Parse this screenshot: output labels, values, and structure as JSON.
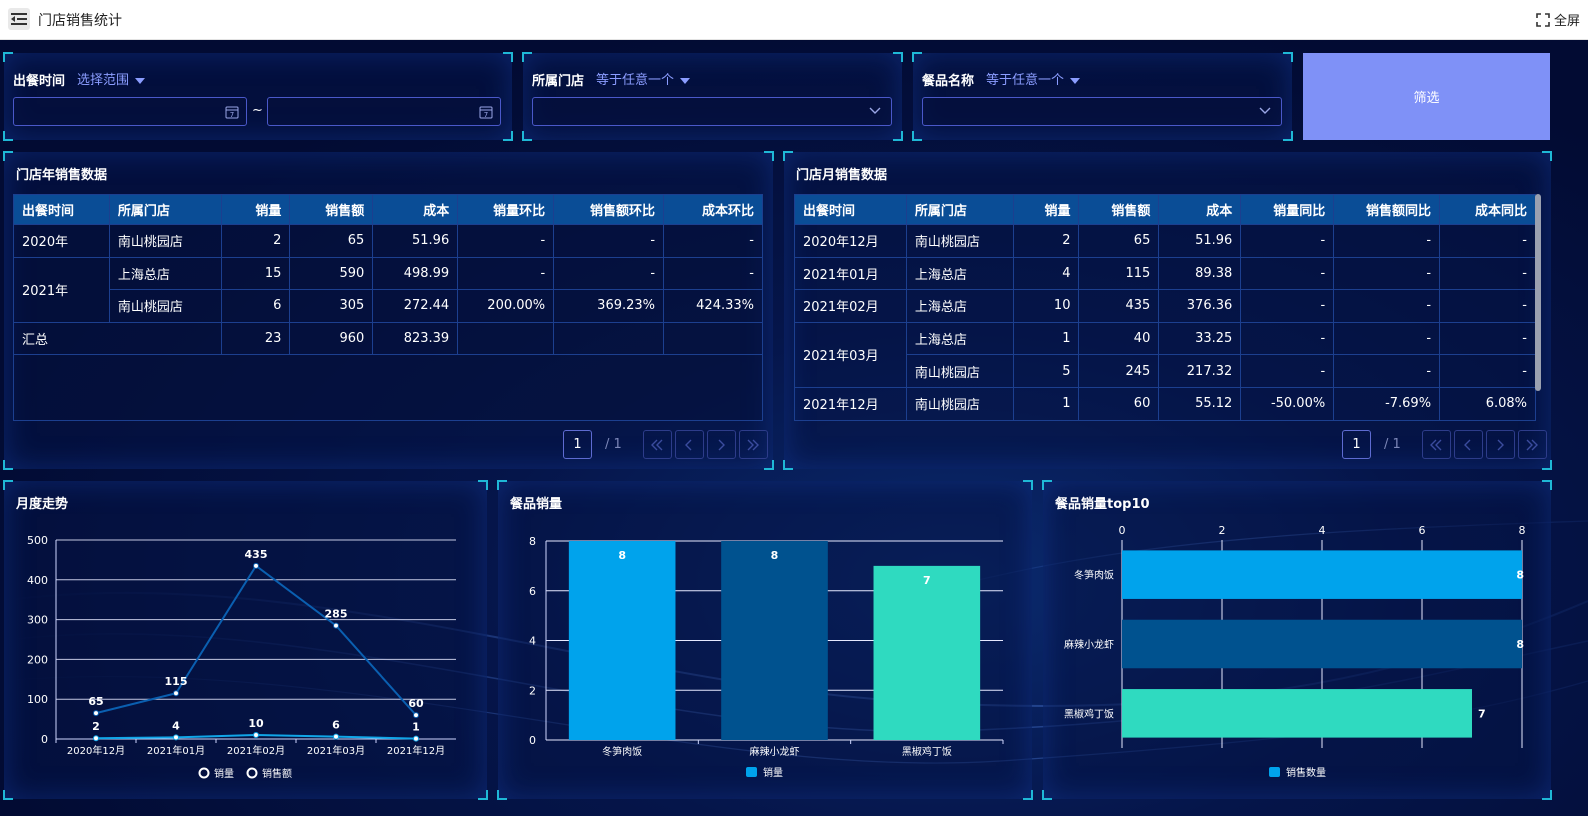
{
  "app": {
    "title": "门店销售统计",
    "fullscreen_label": "全屏"
  },
  "filters": {
    "time_label": "出餐时间",
    "time_op": "选择范围",
    "range_sep": "~",
    "store_label": "所属门店",
    "store_op": "等于任意一个",
    "meal_label": "餐品名称",
    "meal_op": "等于任意一个",
    "submit_label": "筛选"
  },
  "year_table": {
    "title": "门店年销售数据",
    "headers": [
      "出餐时间",
      "所属门店",
      "销量",
      "销售额",
      "成本",
      "销量环比",
      "销售额环比",
      "成本环比"
    ],
    "rows": [
      [
        "2020年",
        "南山桃园店",
        "2",
        "65",
        "51.96",
        "-",
        "-",
        "-"
      ],
      [
        "2021年",
        "上海总店",
        "15",
        "590",
        "498.99",
        "-",
        "-",
        "-"
      ],
      [
        "",
        "南山桃园店",
        "6",
        "305",
        "272.44",
        "200.00%",
        "369.23%",
        "424.33%"
      ]
    ],
    "total": {
      "label": "汇总",
      "qty": "23",
      "amount": "960",
      "cost": "823.39"
    },
    "page": "1",
    "pages": "/ 1"
  },
  "month_table": {
    "title": "门店月销售数据",
    "headers": [
      "出餐时间",
      "所属门店",
      "销量",
      "销售额",
      "成本",
      "销量同比",
      "销售额同比",
      "成本同比"
    ],
    "rows": [
      [
        "2020年12月",
        "南山桃园店",
        "2",
        "65",
        "51.96",
        "-",
        "-",
        "-"
      ],
      [
        "2021年01月",
        "上海总店",
        "4",
        "115",
        "89.38",
        "-",
        "-",
        "-"
      ],
      [
        "2021年02月",
        "上海总店",
        "10",
        "435",
        "376.36",
        "-",
        "-",
        "-"
      ],
      [
        "2021年03月",
        "上海总店",
        "1",
        "40",
        "33.25",
        "-",
        "-",
        "-"
      ],
      [
        "",
        "南山桃园店",
        "5",
        "245",
        "217.32",
        "-",
        "-",
        "-"
      ],
      [
        "2021年12月",
        "南山桃园店",
        "1",
        "60",
        "55.12",
        "-50.00%",
        "-7.69%",
        "6.08%"
      ]
    ],
    "page": "1",
    "pages": "/ 1"
  },
  "line_panel_title": "月度走势",
  "bar_panel_title": "餐品销量",
  "hbar_panel_title": "餐品销量top10",
  "colors": {
    "accent": "#7f91f7",
    "bar1": "#00a3ec",
    "bar2": "#00528f",
    "bar3": "#2fdac0",
    "line_amount": "#0a5fb0",
    "line_qty": "#11a6e8"
  },
  "chart_data": [
    {
      "type": "line",
      "title": "月度走势",
      "x": [
        "2020年12月",
        "2021年01月",
        "2021年02月",
        "2021年03月",
        "2021年12月"
      ],
      "series": [
        {
          "name": "销量",
          "values": [
            2,
            4,
            10,
            6,
            1
          ]
        },
        {
          "name": "销售额",
          "values": [
            65,
            115,
            435,
            285,
            60
          ]
        }
      ],
      "ylim": [
        0,
        500
      ],
      "yticks": [
        0,
        100,
        200,
        300,
        400,
        500
      ],
      "grid": true,
      "legend": "bottom"
    },
    {
      "type": "bar",
      "title": "餐品销量",
      "categories": [
        "冬笋肉饭",
        "麻辣小龙虾",
        "黑椒鸡丁饭"
      ],
      "series": [
        {
          "name": "销量",
          "values": [
            8,
            8,
            7
          ]
        }
      ],
      "ylim": [
        0,
        8
      ],
      "yticks": [
        0,
        2,
        4,
        6,
        8
      ],
      "grid": true,
      "legend": "bottom"
    },
    {
      "type": "bar",
      "orientation": "horizontal",
      "title": "餐品销量top10",
      "categories": [
        "冬笋肉饭",
        "麻辣小龙虾",
        "黑椒鸡丁饭"
      ],
      "series": [
        {
          "name": "销售数量",
          "values": [
            8,
            8,
            7
          ]
        }
      ],
      "xlim": [
        0,
        8
      ],
      "xticks": [
        0,
        2,
        4,
        6,
        8
      ],
      "grid": true,
      "legend": "bottom"
    }
  ]
}
